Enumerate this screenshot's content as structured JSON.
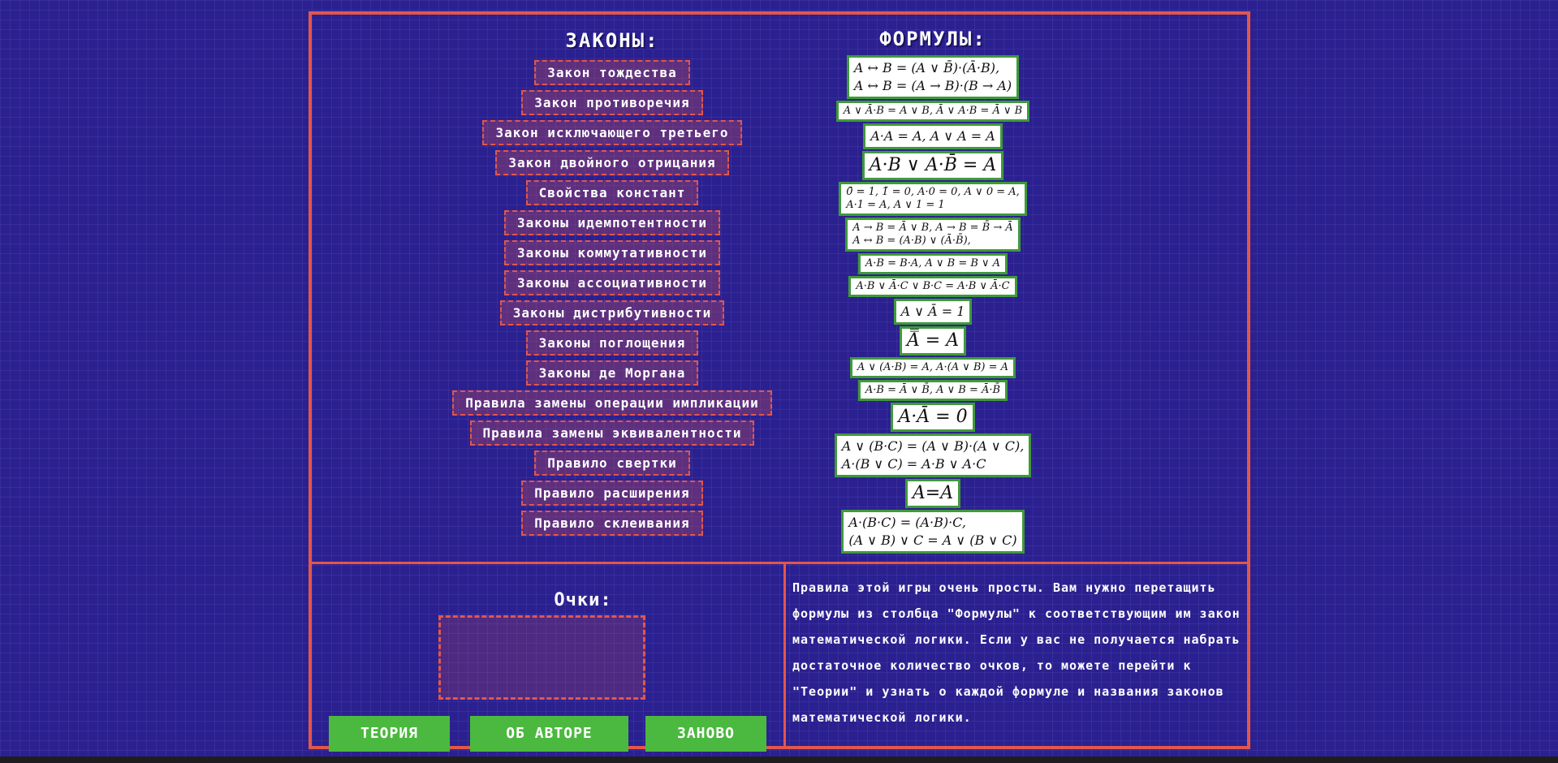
{
  "laws": {
    "title": "ЗАКОНЫ:",
    "items": [
      "Закон тождества",
      "Закон противоречия",
      "Закон исключающего третьего",
      "Закон двойного отрицания",
      "Свойства констант",
      "Законы идемпотентности",
      "Законы коммутативности",
      "Законы ассоциативности",
      "Законы дистрибутивности",
      "Законы поглощения",
      "Законы де Моргана",
      "Правила замены операции импликации",
      "Правила замены эквивалентности",
      "Правило свертки",
      "Правило расширения",
      "Правило склеивания"
    ]
  },
  "formulas": {
    "title": "ФОРМУЛЫ:",
    "items": [
      {
        "lines": [
          "A ↔ B = (A ∨ B̄)·(Ā·B),",
          "A ↔ B = (A → B)·(B → A)"
        ],
        "size": "md"
      },
      {
        "lines": [
          "A ∨ Ā·B = A ∨ B,  Ā ∨ A·B = Ā ∨ B"
        ],
        "size": "sm"
      },
      {
        "lines": [
          "A·A = A,   A ∨ A = A"
        ],
        "size": "md"
      },
      {
        "lines": [
          "A·B ∨ A·B̄ = A"
        ],
        "size": "lg"
      },
      {
        "lines": [
          "0̄ = 1,  1̄ = 0,  A·0 = 0, A ∨ 0 = A,",
          "A·1 = A,   A ∨ 1 = 1"
        ],
        "size": "sm"
      },
      {
        "lines": [
          "A → B = Ā ∨ B,   A → B = B̄ → Ā",
          "A ↔ B = (A·B) ∨ (Ā·B̄),"
        ],
        "size": "sm"
      },
      {
        "lines": [
          "A·B = B·A,   A ∨ B = B ∨ A"
        ],
        "size": "sm"
      },
      {
        "lines": [
          "A·B ∨ Ā·C ∨ B·C = A·B ∨ Ā·C"
        ],
        "size": "sm"
      },
      {
        "lines": [
          "A ∨ Ā = 1"
        ],
        "size": "md"
      },
      {
        "lines": [
          "A̿ = A"
        ],
        "size": "lg"
      },
      {
        "lines": [
          "A ∨ (A·B) = A,  A·(A ∨ B) = A"
        ],
        "size": "sm"
      },
      {
        "lines": [
          "A·B = Ā ∨ B̄,   A ∨ B = Ā·B̄"
        ],
        "size": "sm"
      },
      {
        "lines": [
          "A·Ā = 0"
        ],
        "size": "lg"
      },
      {
        "lines": [
          "A ∨ (B·C) = (A ∨ B)·(A ∨ C),",
          "A·(B ∨ C) = A·B ∨ A·C"
        ],
        "size": "md"
      },
      {
        "lines": [
          "A=A"
        ],
        "size": "lg"
      },
      {
        "lines": [
          "A·(B·C) = (A·B)·C,",
          "(A ∨ B) ∨ C = A ∨ (B ∨ C)"
        ],
        "size": "md"
      }
    ]
  },
  "score": {
    "label": "Очки:",
    "value": ""
  },
  "buttons": {
    "theory": "ТЕОРИЯ",
    "about": "ОБ АВТОРЕ",
    "restart": "ЗАНОВО"
  },
  "rules_text": "Правила этой игры очень просты. Вам нужно перетащить формулы из столбца \"Формулы\" к соответствующим им закон математической логики. Если у вас не получается набрать достаточное количество очков, то можете перейти к \"Теории\" и узнать о каждой формуле и названия законов математической логики.",
  "colors": {
    "background": "#2b2090",
    "border": "#e2574b",
    "button": "#4bb93f",
    "formula_border": "#3f9a3a"
  }
}
